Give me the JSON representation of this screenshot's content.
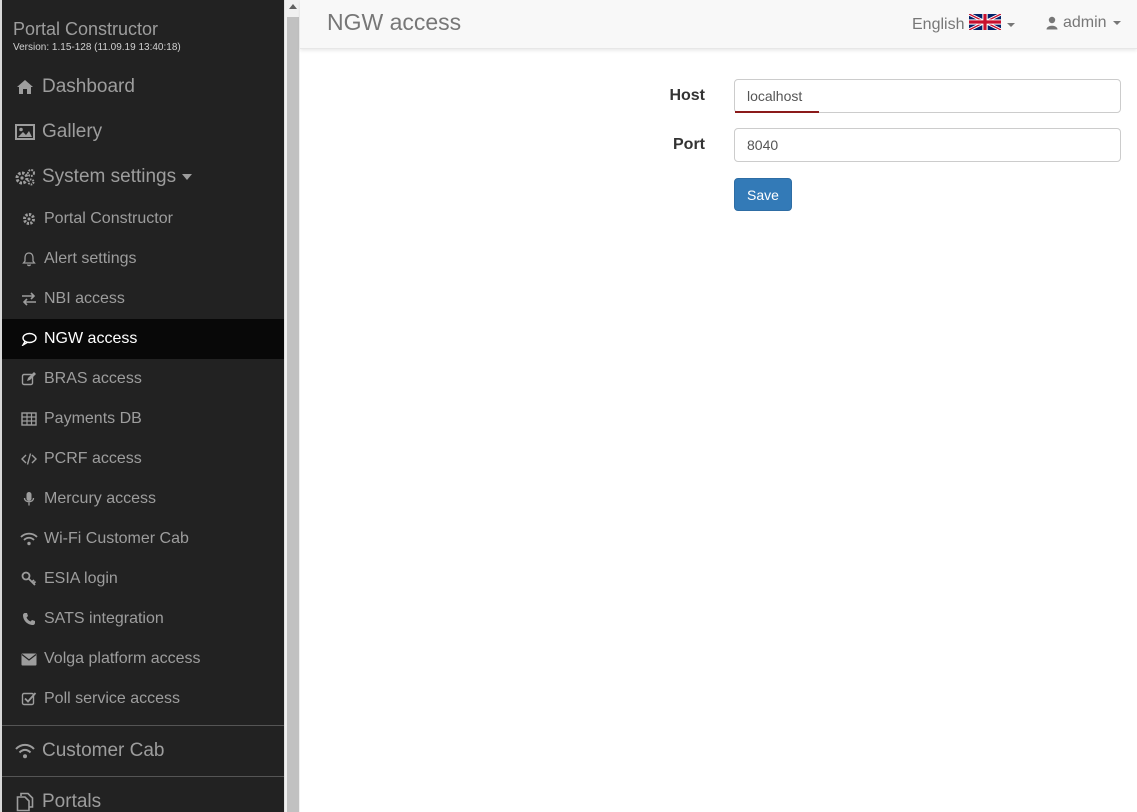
{
  "sidebar": {
    "brand_title": "Portal Constructor",
    "brand_version": "Version: 1.15-128 (11.09.19 13:40:18)",
    "main_items": [
      {
        "label": "Dashboard",
        "icon": "home-icon"
      },
      {
        "label": "Gallery",
        "icon": "image-icon"
      },
      {
        "label": "System settings",
        "icon": "gears-icon"
      }
    ],
    "sub_items": [
      {
        "label": "Portal Constructor",
        "icon": "gear-icon"
      },
      {
        "label": "Alert settings",
        "icon": "bell-icon"
      },
      {
        "label": "NBI access",
        "icon": "exchange-icon"
      },
      {
        "label": "NGW access",
        "icon": "comment-icon",
        "active": true
      },
      {
        "label": "BRAS access",
        "icon": "edit-icon"
      },
      {
        "label": "Payments DB",
        "icon": "table-icon"
      },
      {
        "label": "PCRF access",
        "icon": "code-icon"
      },
      {
        "label": "Mercury access",
        "icon": "microphone-icon"
      },
      {
        "label": "Wi-Fi Customer Cab",
        "icon": "wifi-icon"
      },
      {
        "label": "ESIA login",
        "icon": "key-icon"
      },
      {
        "label": "SATS integration",
        "icon": "phone-icon"
      },
      {
        "label": "Volga platform access",
        "icon": "envelope-icon"
      },
      {
        "label": "Poll service access",
        "icon": "check-square-icon"
      }
    ],
    "bottom_items": [
      {
        "label": "Customer Cab",
        "icon": "wifi-icon"
      },
      {
        "label": "Portals",
        "icon": "copy-icon"
      }
    ]
  },
  "header": {
    "title": "NGW access",
    "language": "English",
    "language_flag": "uk-flag-icon",
    "user": "admin"
  },
  "form": {
    "host_label": "Host",
    "host_value": "localhost",
    "port_label": "Port",
    "port_value": "8040",
    "save_label": "Save"
  },
  "colors": {
    "sidebar_bg": "#222222",
    "active_bg": "#080808",
    "primary": "#337ab7",
    "topbar_bg": "#f8f8f8"
  }
}
